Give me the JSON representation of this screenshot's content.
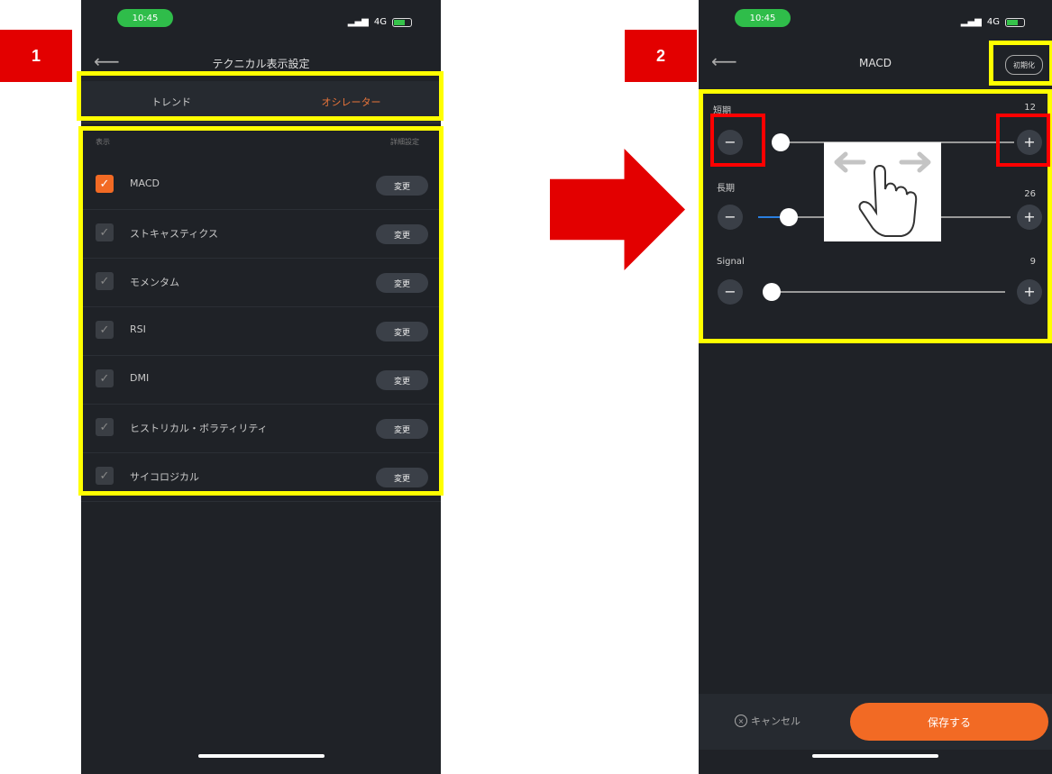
{
  "steps": {
    "first": "1",
    "second": "2"
  },
  "phone1": {
    "time": "10:45",
    "network": "4G",
    "title": "テクニカル表示設定",
    "tabs": [
      {
        "label": "トレンド"
      },
      {
        "label": "オシレーター"
      }
    ],
    "list_header_left": "表示",
    "list_header_right": "詳細設定",
    "change_label": "変更",
    "indicators": [
      {
        "label": "MACD",
        "checked": true
      },
      {
        "label": "ストキャスティクス",
        "checked": true
      },
      {
        "label": "モメンタム",
        "checked": true
      },
      {
        "label": "RSI",
        "checked": true
      },
      {
        "label": "DMI",
        "checked": true
      },
      {
        "label": "ヒストリカル・ボラティリティ",
        "checked": true
      },
      {
        "label": "サイコロジカル",
        "checked": true
      }
    ]
  },
  "phone2": {
    "time": "10:45",
    "network": "4G",
    "title": "MACD",
    "reset_label": "初期化",
    "params": [
      {
        "label": "短期",
        "value": "12",
        "fraction": 0.02
      },
      {
        "label": "長期",
        "value": "26",
        "fraction": 0.12
      },
      {
        "label": "Signal",
        "value": "9",
        "fraction": 0.02
      }
    ],
    "cancel_label": "キャンセル",
    "save_label": "保存する"
  },
  "icons": {
    "back": "back-arrow-icon",
    "minus": "minus-icon",
    "plus": "plus-icon",
    "check": "checkmark-icon",
    "gesture": "swipe-gesture-icon"
  },
  "colors": {
    "accent_orange": "#f26a24",
    "highlight_yellow": "#ffff00",
    "highlight_red": "#ff0000",
    "badge_red": "#e30000"
  }
}
